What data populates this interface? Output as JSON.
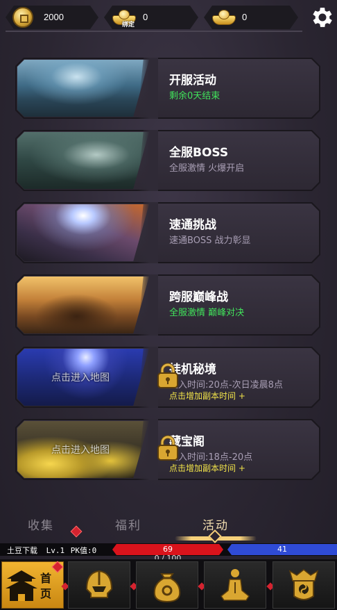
{
  "currency": {
    "copper": "2000",
    "bound_gold": "0",
    "bound_label": "绑定",
    "gold": "0"
  },
  "activities": [
    {
      "title": "开服活动",
      "subtitle": "剩余0天结束",
      "subtitle_color": "#41e35b"
    },
    {
      "title": "全服BOSS",
      "subtitle": "全服激情 火爆开启",
      "subtitle_color": "#a99fb5"
    },
    {
      "title": "速通挑战",
      "subtitle": "速通BOSS 战力彰显",
      "subtitle_color": "#a99fb5"
    },
    {
      "title": "跨服巅峰战",
      "subtitle": "全服激情 巅峰对决",
      "subtitle_color": "#41e35b"
    },
    {
      "title": "挂机秘境",
      "subtitle": "进入时间:20点-次日凌晨8点",
      "subtitle_color": "#a99fb5",
      "action": "点击增加副本时间 +",
      "map_hint": "点击进入地图",
      "locked": true
    },
    {
      "title": "藏宝阁",
      "subtitle": "进入时间:18点-20点",
      "subtitle_color": "#a99fb5",
      "action": "点击增加副本时间 +",
      "map_hint": "点击进入地图",
      "locked": true
    }
  ],
  "tabs": [
    {
      "label": "收集",
      "active": false
    },
    {
      "label": "福利",
      "active": false
    },
    {
      "label": "活动",
      "active": true
    }
  ],
  "status": {
    "player_name": "土豆下载",
    "level": "Lv.1",
    "pk_label": "PK值:0",
    "hp": "69",
    "mp": "41",
    "exp": "0 / 100"
  },
  "nav": {
    "home_label": "首页",
    "items": [
      "home-icon",
      "helmet-icon",
      "money-bag-icon",
      "meditation-icon",
      "potion-icon"
    ]
  },
  "colors": {
    "accent_gold": "#f6d07a",
    "hp": "#d9131c",
    "mp": "#2f4bd6",
    "highlight_green": "#41e35b",
    "action_yellow": "#f2e44a"
  }
}
